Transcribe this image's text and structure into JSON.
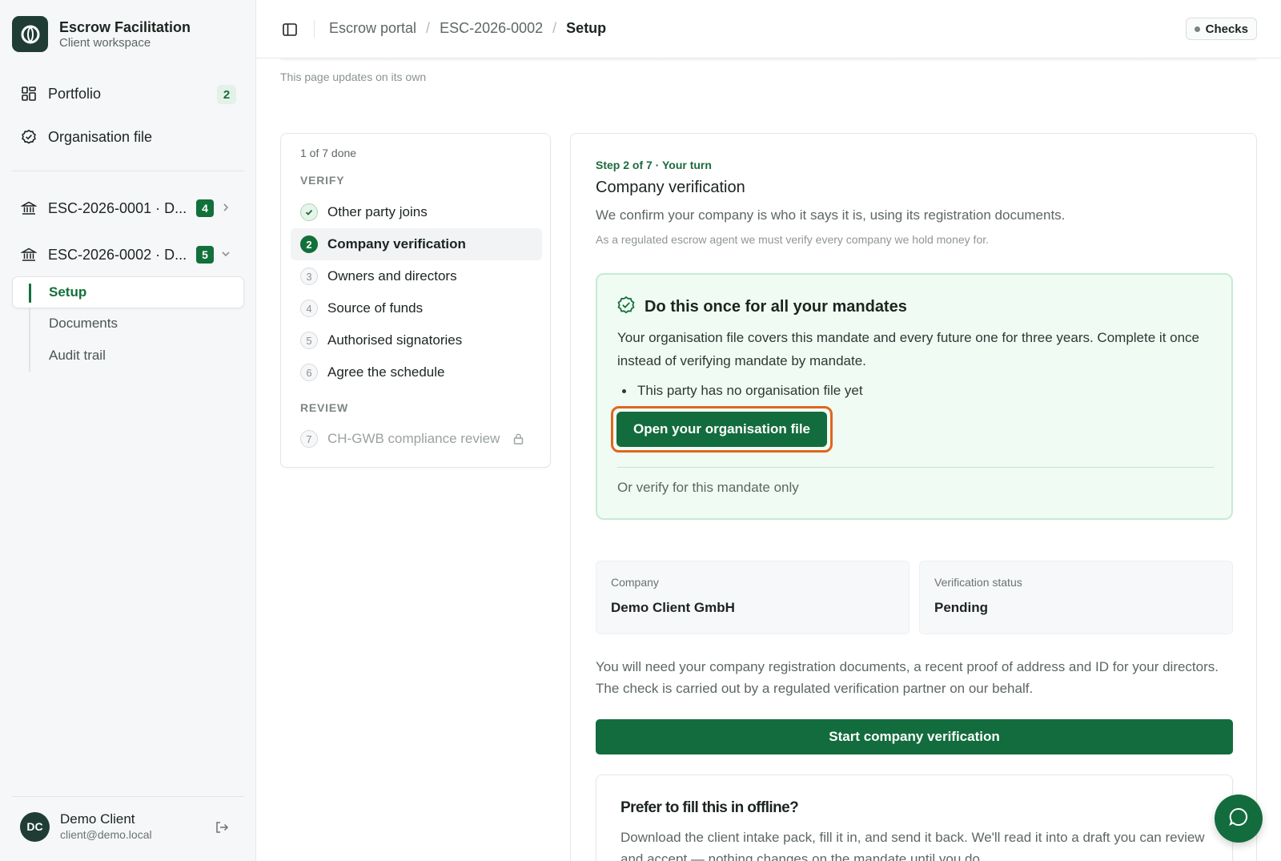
{
  "brand": {
    "title": "Escrow Facilitation",
    "subtitle": "Client workspace"
  },
  "sidebar": {
    "portfolio": {
      "label": "Portfolio",
      "count": "2"
    },
    "org_file": {
      "label": "Organisation file"
    },
    "mandates": [
      {
        "label": "ESC-2026-0001 · D...",
        "count": "4",
        "expanded": false
      },
      {
        "label": "ESC-2026-0002 · D...",
        "count": "5",
        "expanded": true
      }
    ],
    "sub_items": [
      {
        "label": "Setup",
        "active": true
      },
      {
        "label": "Documents"
      },
      {
        "label": "Audit trail"
      }
    ],
    "user": {
      "initials": "DC",
      "name": "Demo Client",
      "email": "client@demo.local"
    }
  },
  "topbar": {
    "breadcrumb": [
      "Escrow portal",
      "ESC-2026-0002",
      "Setup"
    ],
    "checks_label": "Checks"
  },
  "page_note": "This page updates on its own",
  "stepper": {
    "progress": "1 of 7 done",
    "groups": [
      "VERIFY",
      "REVIEW"
    ],
    "steps": [
      {
        "num": "1",
        "label": "Other party joins",
        "state": "done"
      },
      {
        "num": "2",
        "label": "Company verification",
        "state": "current"
      },
      {
        "num": "3",
        "label": "Owners and directors",
        "state": "todo"
      },
      {
        "num": "4",
        "label": "Source of funds",
        "state": "todo"
      },
      {
        "num": "5",
        "label": "Authorised signatories",
        "state": "todo"
      },
      {
        "num": "6",
        "label": "Agree the schedule",
        "state": "todo"
      },
      {
        "num": "7",
        "label": "CH-GWB compliance review",
        "state": "locked"
      }
    ]
  },
  "main": {
    "step_label": "Step 2 of 7 · Your turn",
    "title": "Company verification",
    "description": "We confirm your company is who it says it is, using its registration documents.",
    "note": "As a regulated escrow agent we must verify every company we hold money for.",
    "org_box": {
      "title": "Do this once for all your mandates",
      "text": "Your organisation file covers this mandate and every future one for three years. Complete it once instead of verifying mandate by mandate.",
      "bullet": "This party has no organisation file yet",
      "button": "Open your organisation file",
      "alt_link": "Or verify for this mandate only"
    },
    "company": {
      "label": "Company",
      "value": "Demo Client GmbH"
    },
    "status": {
      "label": "Verification status",
      "value": "Pending"
    },
    "paragraph": "You will need your company registration documents, a recent proof of address and ID for your directors. The check is carried out by a regulated verification partner on our behalf.",
    "primary_button": "Start company verification",
    "offline": {
      "title": "Prefer to fill this in offline?",
      "text": "Download the client intake pack, fill it in, and send it back. We'll read it into a draft you can review and accept — nothing changes on the mandate until you do."
    }
  },
  "colors": {
    "brand_green": "#136c3d",
    "highlight_orange": "#e0661d",
    "mint_bg": "#f0fbf4"
  }
}
